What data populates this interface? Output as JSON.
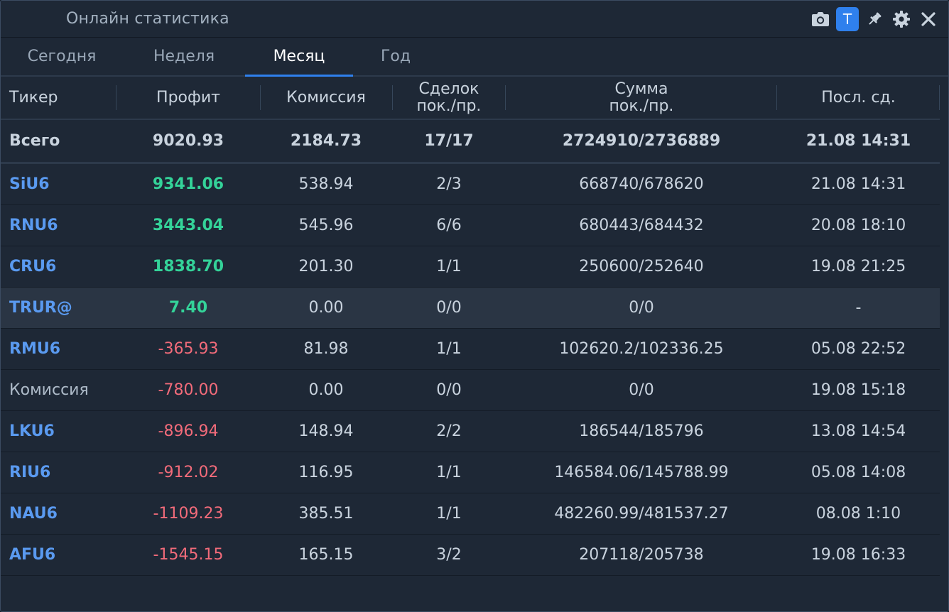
{
  "window": {
    "title": "Онлайн статистика"
  },
  "toolbar": {
    "t_badge": "T"
  },
  "tabs": [
    {
      "label": "Сегодня"
    },
    {
      "label": "Неделя"
    },
    {
      "label": "Месяц"
    },
    {
      "label": "Год"
    }
  ],
  "active_tab": "Месяц",
  "columns": {
    "ticker": "Тикер",
    "profit": "Профит",
    "commission": "Комиссия",
    "deals_line1": "Сделок",
    "deals_line2": "пок./пр.",
    "sum_line1": "Сумма",
    "sum_line2": "пок./пр.",
    "last": "Посл. сд."
  },
  "total": {
    "ticker": "Всего",
    "profit": "9020.93",
    "commission": "2184.73",
    "deals": "17/17",
    "sum": "2724910/2736889",
    "last": "21.08 14:31"
  },
  "rows": [
    {
      "ticker": "SiU6",
      "profit": "9341.06",
      "commission": "538.94",
      "deals": "2/3",
      "sum": "668740/678620",
      "last": "21.08 14:31"
    },
    {
      "ticker": "RNU6",
      "profit": "3443.04",
      "commission": "545.96",
      "deals": "6/6",
      "sum": "680443/684432",
      "last": "20.08 18:10"
    },
    {
      "ticker": "CRU6",
      "profit": "1838.70",
      "commission": "201.30",
      "deals": "1/1",
      "sum": "250600/252640",
      "last": "19.08 21:25"
    },
    {
      "ticker": "TRUR@",
      "profit": "7.40",
      "commission": "0.00",
      "deals": "0/0",
      "sum": "0/0",
      "last": "-"
    },
    {
      "ticker": "RMU6",
      "profit": "-365.93",
      "commission": "81.98",
      "deals": "1/1",
      "sum": "102620.2/102336.25",
      "last": "05.08 22:52"
    },
    {
      "ticker": "Комиссия",
      "profit": "-780.00",
      "commission": "0.00",
      "deals": "0/0",
      "sum": "0/0",
      "last": "19.08 15:18"
    },
    {
      "ticker": "LKU6",
      "profit": "-896.94",
      "commission": "148.94",
      "deals": "2/2",
      "sum": "186544/185796",
      "last": "13.08 14:54"
    },
    {
      "ticker": "RIU6",
      "profit": "-912.02",
      "commission": "116.95",
      "deals": "1/1",
      "sum": "146584.06/145788.99",
      "last": "05.08 14:08"
    },
    {
      "ticker": "NAU6",
      "profit": "-1109.23",
      "commission": "385.51",
      "deals": "1/1",
      "sum": "482260.99/481537.27",
      "last": "08.08 1:10"
    },
    {
      "ticker": "AFU6",
      "profit": "-1545.15",
      "commission": "165.15",
      "deals": "3/2",
      "sum": "207118/205738",
      "last": "19.08 16:33"
    }
  ],
  "colors": {
    "background": "#1e2836",
    "accent": "#2f80ed",
    "profit_positive": "#34d399",
    "profit_negative": "#f26b7a",
    "ticker": "#5a9af0"
  },
  "icons": [
    "camera-icon",
    "pin-icon",
    "gear-icon",
    "close-icon"
  ]
}
